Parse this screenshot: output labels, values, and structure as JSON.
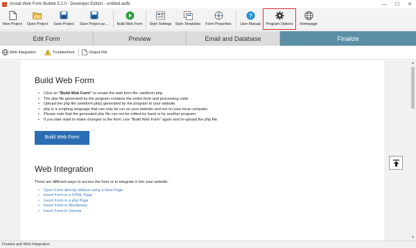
{
  "window": {
    "title": "Arclab Web Form Builder 5.2.0 - Developer Edition - untitled.awfb",
    "controls": [
      "—",
      "☐",
      "✕"
    ]
  },
  "toolbar": {
    "buttons": [
      {
        "label": "New Project",
        "icon": "new-document-icon"
      },
      {
        "label": "Open Project",
        "icon": "folder-open-icon"
      },
      {
        "label": "Save Project",
        "icon": "save-icon"
      },
      {
        "label": "Save Project as ...",
        "icon": "save-as-icon"
      },
      {
        "label": "Build Web Form",
        "icon": "play-icon"
      },
      {
        "label": "Style Settings",
        "icon": "style-settings-icon"
      },
      {
        "label": "Style Templates",
        "icon": "templates-icon"
      },
      {
        "label": "Form Properties",
        "icon": "properties-icon"
      },
      {
        "label": "User Manual",
        "icon": "help-icon"
      },
      {
        "label": "Program Options",
        "icon": "gear-icon"
      },
      {
        "label": "Homepage",
        "icon": "globe-icon"
      }
    ]
  },
  "tabs": [
    "Edit Form",
    "Preview",
    "Email and Database",
    "Finalize"
  ],
  "active_tab": "Finalize",
  "subbar": {
    "items": [
      "Web Integration",
      "Troubleshoot",
      "Output File"
    ]
  },
  "build": {
    "heading": "Build Web Form",
    "intro_prefix": "Click on ",
    "intro_bold": "\"Build Web Form\"",
    "intro_suffix": " to create the web form file: webform.php.",
    "bullets": [
      "The php file generated by the program contains the entire form and processing code.",
      "Upload the php file (webform.php) generated by the program to your website.",
      "php is a scripting language that can only be run on your website and not on your local computer.",
      "Please note that the generated php file can not be edited by hand or by another program.",
      "If you later want to make changes to the form, use \"Build Web Form\" again and re-upload the php file."
    ],
    "button": "Build Web Form"
  },
  "integration": {
    "heading": "Web Integration",
    "text": "There are different ways to access the form or to integrate it into your website:",
    "links": [
      "Open Form directly without using a Host Page",
      "Insert Form in a HTML Page",
      "Insert Form in a php Page",
      "Insert Form in Wordpress",
      "Insert Form in Joomla"
    ]
  },
  "status": "Finalize and Web Integration",
  "colors": {
    "active_tab": "#5b8fa6",
    "primary_button": "#2b6db3",
    "link": "#3a78b8",
    "highlight": "#e03030"
  }
}
